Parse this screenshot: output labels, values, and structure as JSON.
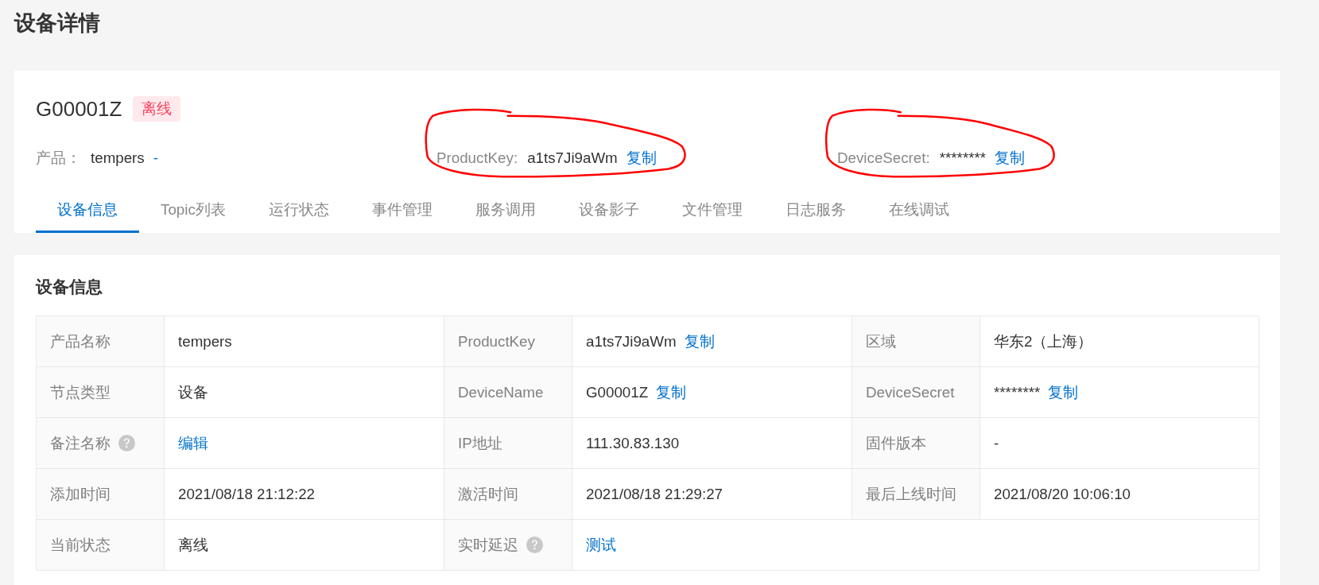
{
  "page": {
    "title": "设备详情"
  },
  "device": {
    "name": "G00001Z",
    "status": "离线"
  },
  "summary": [
    {
      "label": "产品：",
      "value": "tempers",
      "action": "-",
      "circled": false
    },
    {
      "label": "ProductKey:",
      "value": "a1ts7Ji9aWm",
      "action": "复制",
      "circled": true
    },
    {
      "label": "DeviceSecret:",
      "value": "********",
      "action": "复制",
      "circled": true
    }
  ],
  "tabs": [
    {
      "label": "设备信息",
      "selected": true
    },
    {
      "label": "Topic列表",
      "selected": false
    },
    {
      "label": "运行状态",
      "selected": false
    },
    {
      "label": "事件管理",
      "selected": false
    },
    {
      "label": "服务调用",
      "selected": false
    },
    {
      "label": "设备影子",
      "selected": false
    },
    {
      "label": "文件管理",
      "selected": false
    },
    {
      "label": "日志服务",
      "selected": false
    },
    {
      "label": "在线调试",
      "selected": false
    }
  ],
  "info": {
    "title": "设备信息",
    "rows": [
      {
        "fields": [
          {
            "label": "产品名称",
            "help": false,
            "kind": "text",
            "value": "tempers"
          },
          {
            "label": "ProductKey",
            "help": false,
            "kind": "text",
            "value": "a1ts7Ji9aWm",
            "action": "复制"
          },
          {
            "label": "区域",
            "help": false,
            "kind": "text",
            "value": "华东2（上海）"
          }
        ]
      },
      {
        "fields": [
          {
            "label": "节点类型",
            "help": false,
            "kind": "text",
            "value": "设备"
          },
          {
            "label": "DeviceName",
            "help": false,
            "kind": "text",
            "value": "G00001Z",
            "action": "复制"
          },
          {
            "label": "DeviceSecret",
            "help": false,
            "kind": "text",
            "value": "********",
            "action": "复制"
          }
        ]
      },
      {
        "fields": [
          {
            "label": "备注名称",
            "help": true,
            "kind": "link",
            "value": "编辑"
          },
          {
            "label": "IP地址",
            "help": false,
            "kind": "text",
            "value": "111.30.83.130"
          },
          {
            "label": "固件版本",
            "help": false,
            "kind": "text",
            "value": "-"
          }
        ]
      },
      {
        "fields": [
          {
            "label": "添加时间",
            "help": false,
            "kind": "text",
            "value": "2021/08/18 21:12:22"
          },
          {
            "label": "激活时间",
            "help": false,
            "kind": "text",
            "value": "2021/08/18 21:29:27"
          },
          {
            "label": "最后上线时间",
            "help": false,
            "kind": "text",
            "value": "2021/08/20 10:06:10"
          }
        ]
      },
      {
        "fields": [
          {
            "label": "当前状态",
            "help": false,
            "kind": "text",
            "value": "离线"
          },
          {
            "label": "实时延迟",
            "help": true,
            "kind": "link",
            "value": "测试"
          }
        ]
      }
    ]
  }
}
